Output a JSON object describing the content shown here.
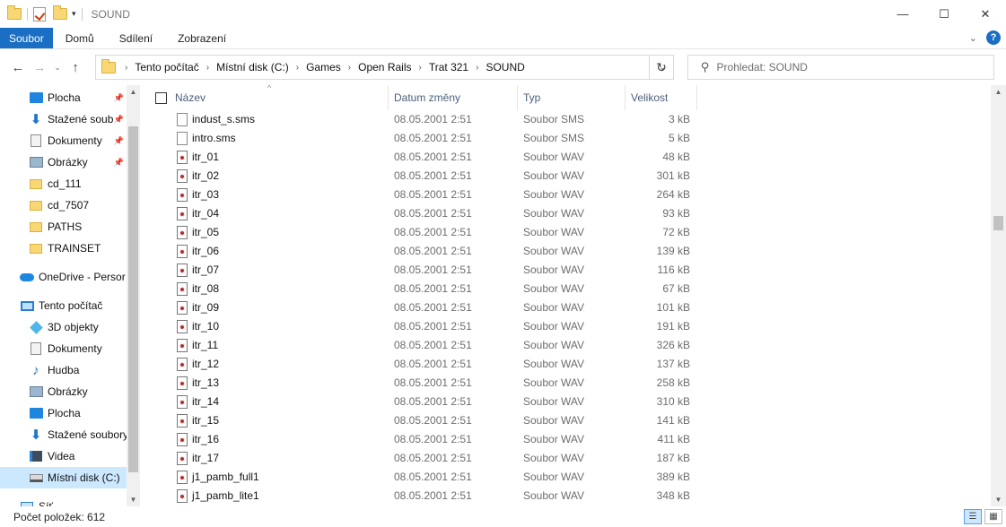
{
  "window": {
    "title": "SOUND",
    "minimize_glyph": "—",
    "maximize_glyph": "☐",
    "close_glyph": "✕",
    "qa_dropdown_glyph": "▾"
  },
  "ribbon": {
    "tabs": [
      "Soubor",
      "Domů",
      "Sdílení",
      "Zobrazení"
    ],
    "expand_glyph": "⌄",
    "help_glyph": "?"
  },
  "nav": {
    "back_glyph": "←",
    "forward_glyph": "→",
    "recent_glyph": "⌄",
    "up_glyph": "↑",
    "refresh_glyph": "↻",
    "address_dropdown_glyph": "⌄"
  },
  "address": {
    "crumbs": [
      "Tento počítač",
      "Místní disk (C:)",
      "Games",
      "Open Rails",
      "Trat 321",
      "SOUND"
    ]
  },
  "search": {
    "placeholder": "Prohledat: SOUND",
    "icon_glyph": "⚲"
  },
  "navpane": {
    "pin_glyph": "📌",
    "items": [
      {
        "label": "Plocha",
        "icon": "desktop-icon",
        "pinned": true
      },
      {
        "label": "Stažené soub",
        "icon": "download-icon",
        "pinned": true
      },
      {
        "label": "Dokumenty",
        "icon": "document-icon",
        "pinned": true
      },
      {
        "label": "Obrázky",
        "icon": "picture-icon",
        "pinned": true
      },
      {
        "label": "cd_111",
        "icon": "folder-icon",
        "pinned": false
      },
      {
        "label": "cd_7507",
        "icon": "folder-icon",
        "pinned": false
      },
      {
        "label": "PATHS",
        "icon": "folder-icon",
        "pinned": false
      },
      {
        "label": "TRAINSET",
        "icon": "folder-icon",
        "pinned": false
      },
      {
        "label": "OneDrive - Persor",
        "icon": "cloud-icon",
        "pinned": false
      },
      {
        "label": "Tento počítač",
        "icon": "computer-icon",
        "pinned": false
      },
      {
        "label": "3D objekty",
        "icon": "3d-objects-icon",
        "pinned": false
      },
      {
        "label": "Dokumenty",
        "icon": "document-icon",
        "pinned": false
      },
      {
        "label": "Hudba",
        "icon": "music-icon",
        "pinned": false
      },
      {
        "label": "Obrázky",
        "icon": "picture-icon",
        "pinned": false
      },
      {
        "label": "Plocha",
        "icon": "desktop-icon",
        "pinned": false
      },
      {
        "label": "Stažené soubory",
        "icon": "download-icon",
        "pinned": false
      },
      {
        "label": "Videa",
        "icon": "video-icon",
        "pinned": false
      },
      {
        "label": "Místní disk (C:)",
        "icon": "disk-icon",
        "pinned": false,
        "selected": true
      },
      {
        "label": "Síť",
        "icon": "network-icon",
        "pinned": false
      }
    ]
  },
  "columns": {
    "name": "Název",
    "date": "Datum změny",
    "type": "Typ",
    "size": "Velikost",
    "sort_glyph": "^"
  },
  "scroll_glyphs": {
    "up": "▲",
    "down": "▼"
  },
  "files": [
    {
      "name": "indust_s.sms",
      "date": "08.05.2001 2:51",
      "type": "Soubor SMS",
      "size": "3 kB",
      "kind": "sms"
    },
    {
      "name": "intro.sms",
      "date": "08.05.2001 2:51",
      "type": "Soubor SMS",
      "size": "5 kB",
      "kind": "sms"
    },
    {
      "name": "itr_01",
      "date": "08.05.2001 2:51",
      "type": "Soubor WAV",
      "size": "48 kB",
      "kind": "wav"
    },
    {
      "name": "itr_02",
      "date": "08.05.2001 2:51",
      "type": "Soubor WAV",
      "size": "301 kB",
      "kind": "wav"
    },
    {
      "name": "itr_03",
      "date": "08.05.2001 2:51",
      "type": "Soubor WAV",
      "size": "264 kB",
      "kind": "wav"
    },
    {
      "name": "itr_04",
      "date": "08.05.2001 2:51",
      "type": "Soubor WAV",
      "size": "93 kB",
      "kind": "wav"
    },
    {
      "name": "itr_05",
      "date": "08.05.2001 2:51",
      "type": "Soubor WAV",
      "size": "72 kB",
      "kind": "wav"
    },
    {
      "name": "itr_06",
      "date": "08.05.2001 2:51",
      "type": "Soubor WAV",
      "size": "139 kB",
      "kind": "wav"
    },
    {
      "name": "itr_07",
      "date": "08.05.2001 2:51",
      "type": "Soubor WAV",
      "size": "116 kB",
      "kind": "wav"
    },
    {
      "name": "itr_08",
      "date": "08.05.2001 2:51",
      "type": "Soubor WAV",
      "size": "67 kB",
      "kind": "wav"
    },
    {
      "name": "itr_09",
      "date": "08.05.2001 2:51",
      "type": "Soubor WAV",
      "size": "101 kB",
      "kind": "wav"
    },
    {
      "name": "itr_10",
      "date": "08.05.2001 2:51",
      "type": "Soubor WAV",
      "size": "191 kB",
      "kind": "wav"
    },
    {
      "name": "itr_11",
      "date": "08.05.2001 2:51",
      "type": "Soubor WAV",
      "size": "326 kB",
      "kind": "wav"
    },
    {
      "name": "itr_12",
      "date": "08.05.2001 2:51",
      "type": "Soubor WAV",
      "size": "137 kB",
      "kind": "wav"
    },
    {
      "name": "itr_13",
      "date": "08.05.2001 2:51",
      "type": "Soubor WAV",
      "size": "258 kB",
      "kind": "wav"
    },
    {
      "name": "itr_14",
      "date": "08.05.2001 2:51",
      "type": "Soubor WAV",
      "size": "310 kB",
      "kind": "wav"
    },
    {
      "name": "itr_15",
      "date": "08.05.2001 2:51",
      "type": "Soubor WAV",
      "size": "141 kB",
      "kind": "wav"
    },
    {
      "name": "itr_16",
      "date": "08.05.2001 2:51",
      "type": "Soubor WAV",
      "size": "411 kB",
      "kind": "wav"
    },
    {
      "name": "itr_17",
      "date": "08.05.2001 2:51",
      "type": "Soubor WAV",
      "size": "187 kB",
      "kind": "wav"
    },
    {
      "name": "j1_pamb_full1",
      "date": "08.05.2001 2:51",
      "type": "Soubor WAV",
      "size": "389 kB",
      "kind": "wav"
    },
    {
      "name": "j1_pamb_lite1",
      "date": "08.05.2001 2:51",
      "type": "Soubor WAV",
      "size": "348 kB",
      "kind": "wav"
    }
  ],
  "status": {
    "item_count": "Počet položek: 612",
    "details_view_glyph": "☰",
    "tiles_view_glyph": "▦"
  },
  "colors": {
    "accent": "#1a6ec3",
    "selection": "#cce8ff",
    "header_text": "#4c607a"
  }
}
